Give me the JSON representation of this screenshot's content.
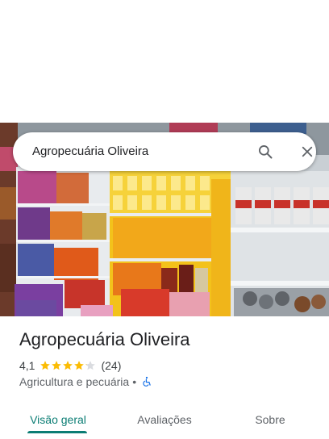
{
  "search": {
    "query": "Agropecuária Oliveira"
  },
  "place": {
    "name": "Agropecuária Oliveira",
    "rating_text": "4,1",
    "rating_value": 4.1,
    "rating_max": 5,
    "review_count": "(24)",
    "category": "Agricultura e pecuária",
    "separator": "•",
    "accessibility_icon": "wheelchair-icon"
  },
  "tabs": [
    {
      "label": "Visão geral",
      "selected": true
    },
    {
      "label": "Avaliações",
      "selected": false
    },
    {
      "label": "Sobre",
      "selected": false
    }
  ],
  "colors": {
    "accent": "#0b7d74",
    "star": "#fbbc04",
    "star_empty": "#dadce0",
    "wheelchair": "#1a73e8"
  },
  "photo": {
    "description_icon": "store-shelves-photo"
  }
}
